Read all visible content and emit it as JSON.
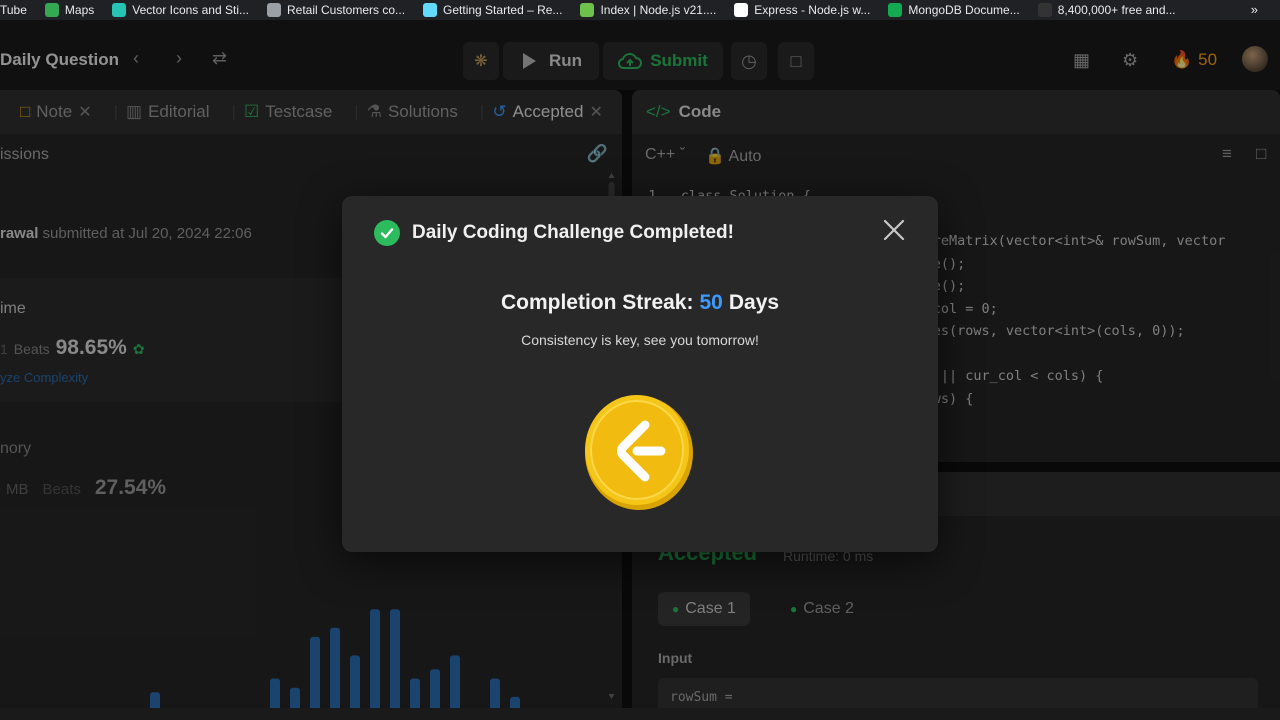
{
  "bookmarks": [
    {
      "label": "Tube",
      "icon": "youtube-icon",
      "color": "#ff0000"
    },
    {
      "label": "Maps",
      "icon": "maps-icon",
      "color": "#34a853"
    },
    {
      "label": "Vector Icons and Sti...",
      "icon": "vector-icons-icon",
      "color": "#27c4b3"
    },
    {
      "label": "Retail Customers co...",
      "icon": "globe-icon",
      "color": "#9aa0a6"
    },
    {
      "label": "Getting Started – Re...",
      "icon": "react-icon",
      "color": "#61dafb"
    },
    {
      "label": "Index | Node.js v21....",
      "icon": "nodejs-icon",
      "color": "#6cc24a"
    },
    {
      "label": "Express - Node.js w...",
      "icon": "express-icon",
      "color": "#ffffff"
    },
    {
      "label": "MongoDB Docume...",
      "icon": "mongodb-icon",
      "color": "#13aa52"
    },
    {
      "label": "8,400,000+ free and...",
      "icon": "freepik-icon",
      "color": "#333333"
    }
  ],
  "bookmarks_more": "»",
  "nav": {
    "title": "Daily Question",
    "run_label": "Run",
    "submit_label": "Submit",
    "streak_count": "50"
  },
  "left": {
    "tabs": [
      {
        "label": "Note",
        "icon": "note-icon",
        "closable": true,
        "active": false
      },
      {
        "label": "Editorial",
        "icon": "book-icon",
        "closable": false,
        "active": false
      },
      {
        "label": "Testcase",
        "icon": "checkbox-icon",
        "closable": false,
        "active": false
      },
      {
        "label": "Solutions",
        "icon": "flask-icon",
        "closable": false,
        "active": false
      },
      {
        "label": "Accepted",
        "icon": "history-icon",
        "closable": true,
        "active": true
      }
    ],
    "section_title": "issions",
    "author_name": "rawal",
    "submitted_text": " submitted at Jul 20, 2024 22:06",
    "runtime_label": "ime",
    "runtime_unit": "1",
    "beats_label": "Beats",
    "runtime_beats": "98.65%",
    "analyze_label": "yze Complexity",
    "memory_label": "nory",
    "memory_unit": "MB",
    "memory_beats_label": "Beats",
    "memory_beats": "27.54%"
  },
  "code": {
    "header": "Code",
    "language": "C++",
    "mode": "Auto",
    "lines": [
      "  1   class Solution {",
      "",
      "                                  storeMatrix(vector<int>& rowSum, vector",
      "                                  size();",
      "                                  size();",
      "                                  ur_col = 0;",
      "                                  > res(rows, vector<int>(cols, 0));",
      "",
      "                                  ows || cur_col < cols) {",
      "                                   rows) {"
    ]
  },
  "result": {
    "status": "Accepted",
    "runtime": "Runtime: 0 ms",
    "cases": [
      "Case 1",
      "Case 2"
    ],
    "input_label": "Input",
    "rowsum_label": "rowSum ="
  },
  "modal": {
    "title": "Daily Coding Challenge Completed!",
    "streak_prefix": "Completion Streak:",
    "streak_value": "50",
    "streak_suffix": "Days",
    "message": "Consistency is key, see you tomorrow!"
  },
  "colors": {
    "accent_green": "#2cbb5d",
    "streak_blue": "#3d9bff",
    "fire_orange": "#ffa116",
    "coin_gold": "#f5c518"
  },
  "chart_data": {
    "type": "bar",
    "values": [
      2,
      0,
      0,
      0,
      0,
      6,
      0,
      0,
      0,
      0,
      0,
      9,
      7,
      18,
      20,
      14,
      24,
      24,
      9,
      11,
      14,
      0,
      9,
      5
    ],
    "ylim": [
      0,
      26
    ]
  }
}
